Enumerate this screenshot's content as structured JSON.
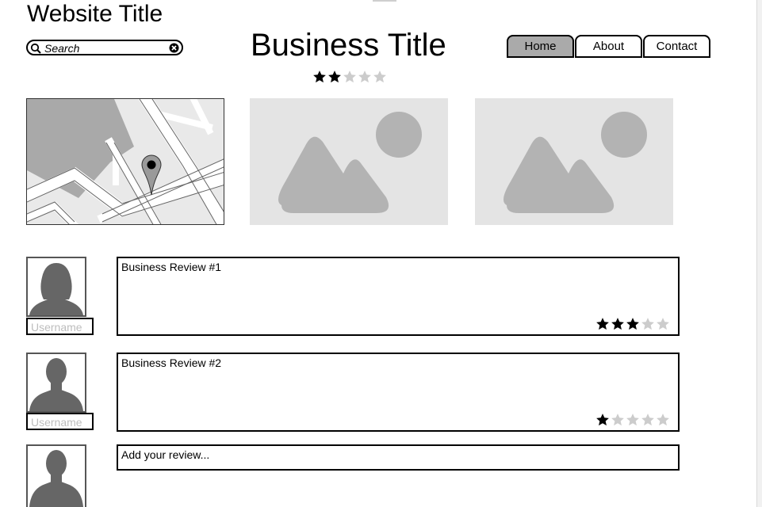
{
  "header": {
    "website_title": "Website Title",
    "search_placeholder": "Search",
    "business_title": "Business Title",
    "business_rating": 2,
    "rating_max": 5
  },
  "nav": {
    "tabs": [
      {
        "label": "Home",
        "active": true
      },
      {
        "label": "About",
        "active": false
      },
      {
        "label": "Contact",
        "active": false
      }
    ]
  },
  "reviews": [
    {
      "username_placeholder": "Username",
      "text": "Business Review #1",
      "rating": 3,
      "avatar": "female-user-icon"
    },
    {
      "username_placeholder": "Username",
      "text": "Business Review #2",
      "rating": 1,
      "avatar": "male-user-icon"
    }
  ],
  "add_review": {
    "placeholder": "Add your review...",
    "avatar": "male-user-icon"
  },
  "colors": {
    "star_filled": "#000000",
    "star_empty": "#cccccc",
    "active_tab": "#aaaaaa",
    "placeholder_bg": "#e4e4e4",
    "placeholder_shape": "#b3b3b3"
  }
}
